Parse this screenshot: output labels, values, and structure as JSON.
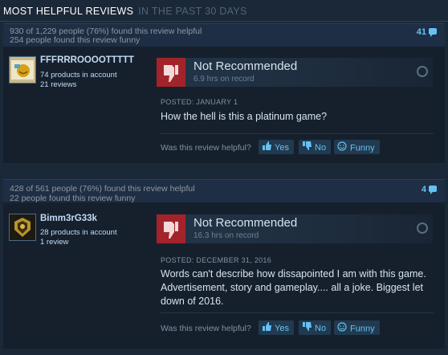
{
  "header": {
    "title": "MOST HELPFUL REVIEWS",
    "subtitle": "IN THE PAST 30 DAYS"
  },
  "reviews": [
    {
      "helpful_line": "930 of 1,229 people (76%) found this review helpful",
      "funny_line": "254 people found this review funny",
      "comment_count": "41",
      "username": "FFFRRROOOOTTTTT",
      "products": "74 products in account",
      "review_count": "21 reviews",
      "verdict": "Not Recommended",
      "hours": "6.9 hrs on record",
      "posted": "POSTED: JANUARY 1",
      "text": "How the hell is this a platinum game?",
      "question": "Was this review helpful?",
      "yes": "Yes",
      "no": "No",
      "funny": "Funny"
    },
    {
      "helpful_line": "428 of 561 people (76%) found this review helpful",
      "funny_line": "22 people found this review funny",
      "comment_count": "4",
      "username": "Bimm3rG33k",
      "products": "28 products in account",
      "review_count": "1 review",
      "verdict": "Not Recommended",
      "hours": "16.3 hrs on record",
      "posted": "POSTED: DECEMBER 31, 2016",
      "text": "Words can't describe how dissapointed I am with this game. Advertisement, story and gameplay.... all a joke. Biggest let down of 2016.",
      "question": "Was this review helpful?",
      "yes": "Yes",
      "no": "No",
      "funny": "Funny"
    }
  ],
  "colors": {
    "background": "#1b2838",
    "accent": "#66c0f4",
    "thumb_down": "#a3232a"
  },
  "icons": [
    "thumbs-down-icon",
    "thumbs-up-icon",
    "smiley-icon",
    "comment-bubble-icon",
    "steam-icon"
  ]
}
